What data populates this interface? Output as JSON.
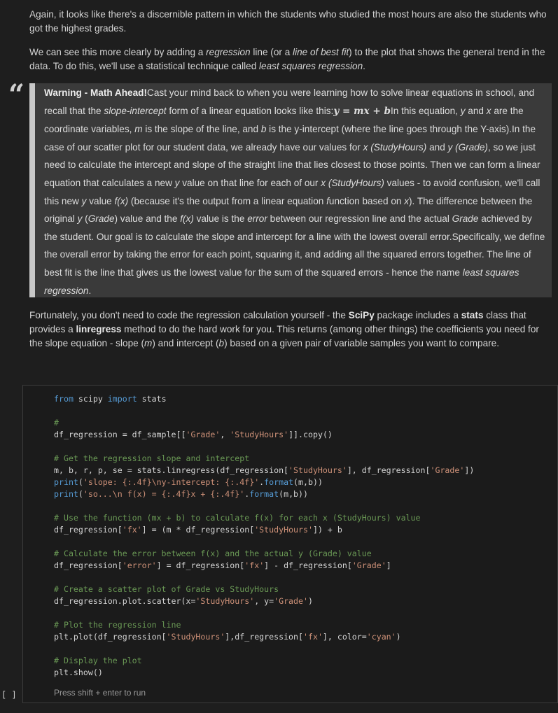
{
  "para1": {
    "text": "Again, it looks like there's a discernible pattern in which the students who studied the most hours are also the students who got the highest grades."
  },
  "para2": {
    "t1": "We can see this more clearly by adding a ",
    "e1": "regression",
    "t2": " line (or a ",
    "e2": "line of best fit",
    "t3": ") to the plot that shows the general trend in the data. To do this, we'll use a statistical technique called ",
    "e3": "least squares regression",
    "t4": "."
  },
  "quote": {
    "mark": "“",
    "title": "Warning - Math Ahead!",
    "t1": "Cast your mind back to when you were learning how to solve linear equations in school, and recall that the ",
    "e1": "slope-intercept",
    "t2": " form of a linear equation looks like this:",
    "math": "y = mx + b",
    "t3": "In this equation, ",
    "e2": "y",
    "t4": " and ",
    "e3": "x",
    "t5": " are the coordinate variables, ",
    "e4": "m",
    "t6": " is the slope of the line, and ",
    "e5": "b",
    "t7": " is the y-intercept (where the line goes through the Y-axis).In the case of our scatter plot for our student data, we already have our values for ",
    "e6": "x (StudyHours)",
    "t8": " and ",
    "e7": "y (Grade)",
    "t9": ", so we just need to calculate the intercept and slope of the straight line that lies closest to those points. Then we can form a linear equation that calculates a new ",
    "e8": "y",
    "t10": " value on that line for each of our ",
    "e9": "x (StudyHours)",
    "t11": " values - to avoid confusion, we'll call this new ",
    "e10": "y",
    "t12": " value ",
    "e11": "f(x)",
    "t13": " (because it's the output from a linear equation ",
    "e12": "f",
    "t14": "unction based on ",
    "e13": "x",
    "t15": "). The difference between the original ",
    "e14": "y",
    "t16": " (",
    "e15": "Grade",
    "t17": ") value and the ",
    "e16": "f(x)",
    "t18": " value is the ",
    "e17": "error",
    "t19": " between our regression line and the actual ",
    "e18": "Grade",
    "t20": " achieved by the student. Our goal is to calculate the slope and intercept for a line with the lowest overall error.Specifically, we define the overall error by taking the error for each point, squaring it, and adding all the squared errors together. The line of best fit is the line that gives us the lowest value for the sum of the squared errors - hence the name ",
    "e19": "least squares regression",
    "t21": "."
  },
  "para3": {
    "t1": "Fortunately, you don't need to code the regression calculation yourself - the ",
    "b1": "SciPy",
    "t2": " package includes a ",
    "b2": "stats",
    "t3": " class that provides a ",
    "b3": "linregress",
    "t4": " method to do the hard work for you. This returns (among other things) the coefficients you need for the slope equation - slope (",
    "e1": "m",
    "t5": ") and intercept (",
    "e2": "b",
    "t6": ") based on a given pair of variable samples you want to compare."
  },
  "code": {
    "l1_k1": "from",
    "l1_t1": " scipy ",
    "l1_k2": "import",
    "l1_t2": " stats",
    "l3_c": "#",
    "l4_t1": "df_regression = df_sample[[",
    "l4_s1": "'Grade'",
    "l4_t2": ", ",
    "l4_s2": "'StudyHours'",
    "l4_t3": "]].copy()",
    "l6_c": "# Get the regression slope and intercept",
    "l7_t1": "m, b, r, p, se = stats.linregress(df_regression[",
    "l7_s1": "'StudyHours'",
    "l7_t2": "], df_regression[",
    "l7_s2": "'Grade'",
    "l7_t3": "])",
    "l8_k1": "print",
    "l8_t1": "(",
    "l8_s1": "'slope: {:.4f}\\ny-intercept: {:.4f}'",
    "l8_t2": ".",
    "l8_k2": "format",
    "l8_t3": "(m,b))",
    "l9_k1": "print",
    "l9_t1": "(",
    "l9_s1": "'so...\\n f(x) = {:.4f}x + {:.4f}'",
    "l9_t2": ".",
    "l9_k2": "format",
    "l9_t3": "(m,b))",
    "l11_c": "# Use the function (mx + b) to calculate f(x) for each x (StudyHours) value",
    "l12_t1": "df_regression[",
    "l12_s1": "'fx'",
    "l12_t2": "] = (m * df_regression[",
    "l12_s2": "'StudyHours'",
    "l12_t3": "]) + b",
    "l14_c": "# Calculate the error between f(x) and the actual y (Grade) value",
    "l15_t1": "df_regression[",
    "l15_s1": "'error'",
    "l15_t2": "] = df_regression[",
    "l15_s2": "'fx'",
    "l15_t3": "] - df_regression[",
    "l15_s3": "'Grade'",
    "l15_t4": "]",
    "l17_c": "# Create a scatter plot of Grade vs StudyHours",
    "l18_t1": "df_regression.plot.scatter(x=",
    "l18_s1": "'StudyHours'",
    "l18_t2": ", y=",
    "l18_s2": "'Grade'",
    "l18_t3": ")",
    "l20_c": "# Plot the regression line",
    "l21_t1": "plt.plot(df_regression[",
    "l21_s1": "'StudyHours'",
    "l21_t2": "],df_regression[",
    "l21_s2": "'fx'",
    "l21_t3": "], color=",
    "l21_s3": "'cyan'",
    "l21_t4": ")",
    "l23_c": "# Display the plot",
    "l24_t1": "plt.show()"
  },
  "cell": {
    "hint": "Press shift + enter to run",
    "prompt": "[ ]"
  }
}
